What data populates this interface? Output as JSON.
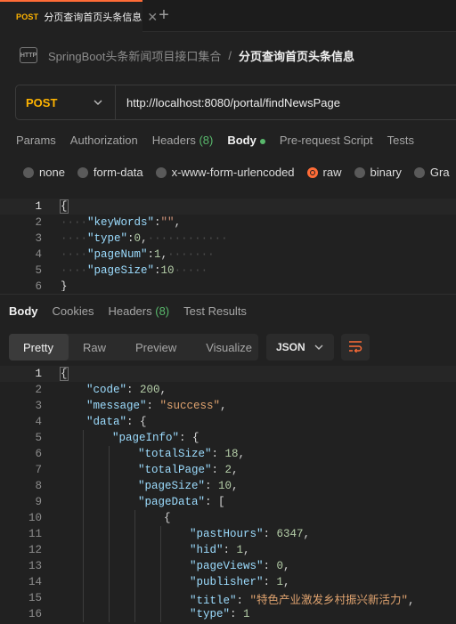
{
  "tab": {
    "method": "POST",
    "title": "分页查询首页头条信息",
    "close": "✕",
    "new_tab": "+"
  },
  "breadcrumb": {
    "icon_text": "HTTP",
    "parent": "SpringBoot头条新闻项目接口集合",
    "separator": "/",
    "current": "分页查询首页头条信息"
  },
  "request": {
    "method": "POST",
    "url": "http://localhost:8080/portal/findNewsPage",
    "tabs": [
      {
        "label": "Params"
      },
      {
        "label": "Authorization"
      },
      {
        "label": "Headers",
        "count": "(8)"
      },
      {
        "label": "Body",
        "active": true
      },
      {
        "label": "Pre-request Script"
      },
      {
        "label": "Tests"
      }
    ],
    "body_types": [
      "none",
      "form-data",
      "x-www-form-urlencoded",
      "raw",
      "binary",
      "Gra"
    ],
    "body_selected": "raw",
    "body_lines": [
      {
        "n": "1",
        "code": "{"
      },
      {
        "n": "2",
        "key": "\"keyWords\"",
        "colon": ":",
        "str": "\"\"",
        "end": ","
      },
      {
        "n": "3",
        "key": "\"type\"",
        "colon": ":",
        "num": "0",
        "end": ","
      },
      {
        "n": "4",
        "key": "\"pageNum\"",
        "colon": ":",
        "num": "1",
        "end": ","
      },
      {
        "n": "5",
        "key": "\"pageSize\"",
        "colon": ":",
        "num": "10",
        "end": ""
      },
      {
        "n": "6",
        "code": "}"
      }
    ]
  },
  "response": {
    "tabs": [
      {
        "label": "Body",
        "active": true
      },
      {
        "label": "Cookies"
      },
      {
        "label": "Headers",
        "count": "(8)"
      },
      {
        "label": "Test Results"
      }
    ],
    "views": [
      "Pretty",
      "Raw",
      "Preview",
      "Visualize"
    ],
    "active_view": "Pretty",
    "format": "JSON",
    "lines": [
      {
        "n": "1",
        "p": "{"
      },
      {
        "n": "2",
        "k": "\"code\"",
        "p": ": ",
        "v": "200",
        "t": "n",
        "e": ","
      },
      {
        "n": "3",
        "k": "\"message\"",
        "p": ": ",
        "v": "\"success\"",
        "t": "s",
        "e": ","
      },
      {
        "n": "4",
        "k": "\"data\"",
        "p": ": {"
      },
      {
        "n": "5",
        "k": "\"pageInfo\"",
        "p": ": {"
      },
      {
        "n": "6",
        "k": "\"totalSize\"",
        "p": ": ",
        "v": "18",
        "t": "n",
        "e": ","
      },
      {
        "n": "7",
        "k": "\"totalPage\"",
        "p": ": ",
        "v": "2",
        "t": "n",
        "e": ","
      },
      {
        "n": "8",
        "k": "\"pageSize\"",
        "p": ": ",
        "v": "10",
        "t": "n",
        "e": ","
      },
      {
        "n": "9",
        "k": "\"pageData\"",
        "p": ": ["
      },
      {
        "n": "10",
        "p": "{"
      },
      {
        "n": "11",
        "k": "\"pastHours\"",
        "p": ": ",
        "v": "6347",
        "t": "n",
        "e": ","
      },
      {
        "n": "12",
        "k": "\"hid\"",
        "p": ": ",
        "v": "1",
        "t": "n",
        "e": ","
      },
      {
        "n": "13",
        "k": "\"pageViews\"",
        "p": ": ",
        "v": "0",
        "t": "n",
        "e": ","
      },
      {
        "n": "14",
        "k": "\"publisher\"",
        "p": ": ",
        "v": "1",
        "t": "n",
        "e": ","
      },
      {
        "n": "15",
        "k": "\"title\"",
        "p": ": ",
        "v": "\"特色产业激发乡村振兴新活力\"",
        "t": "s",
        "e": ","
      },
      {
        "n": "16",
        "k": "\"type\"",
        "p": ": ",
        "v": "1",
        "t": "n",
        "e": ""
      }
    ]
  },
  "colors": {
    "accent": "#ff6c37",
    "method": "#ffb400",
    "count": "#59b86c"
  }
}
